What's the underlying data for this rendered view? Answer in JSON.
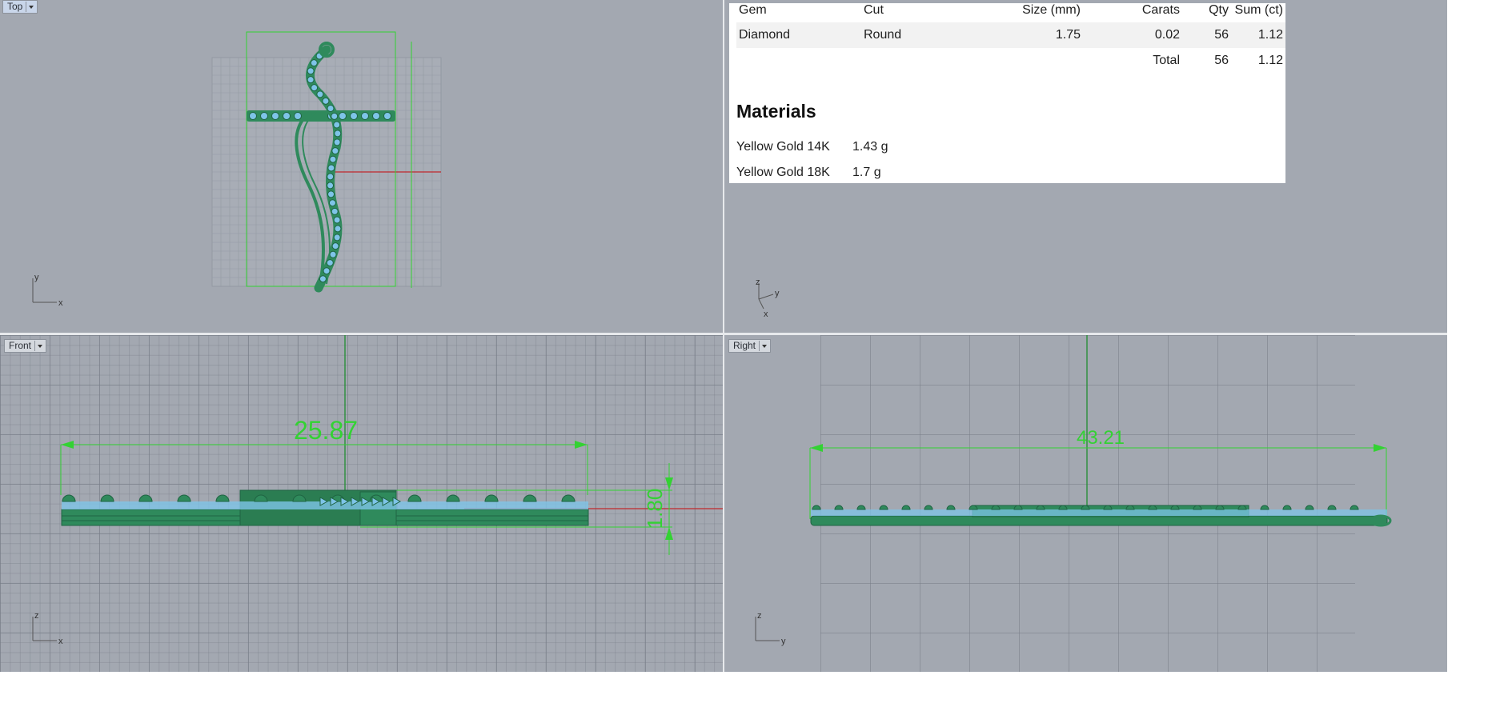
{
  "viewports": {
    "top": {
      "label": "Top",
      "axes": [
        "y",
        "x"
      ]
    },
    "persp": {
      "axes": [
        "z",
        "y",
        "x"
      ]
    },
    "front": {
      "label": "Front",
      "axes": [
        "z",
        "x"
      ],
      "dim_width": "25.87",
      "dim_height": "1.80"
    },
    "right": {
      "label": "Right",
      "axes": [
        "z",
        "y"
      ],
      "dim_width": "43.21"
    }
  },
  "report": {
    "gem_table": {
      "headers": [
        "Gem",
        "Cut",
        "Size (mm)",
        "Carats",
        "Qty",
        "Sum (ct)"
      ],
      "rows": [
        [
          "Diamond",
          "Round",
          "1.75",
          "0.02",
          "56",
          "1.12"
        ]
      ],
      "total": {
        "label": "Total",
        "qty": "56",
        "sum": "1.12"
      }
    },
    "materials_title": "Materials",
    "materials": [
      {
        "name": "Yellow Gold 14K",
        "weight": "1.43 g"
      },
      {
        "name": "Yellow Gold 18K",
        "weight": "1.7 g"
      }
    ]
  },
  "colors": {
    "viewport_bg": "#a3a8b1",
    "model_green": "#2f8a5c",
    "gem_blue": "#7ec4e8",
    "dimension_green": "#33d233",
    "axis_red": "#c0282d"
  }
}
